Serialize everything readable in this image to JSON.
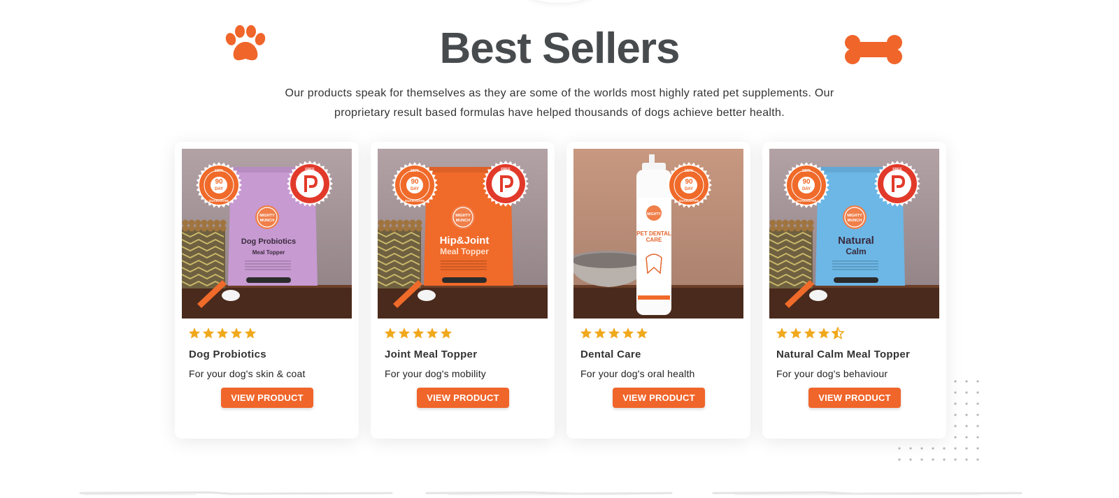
{
  "section": {
    "title": "Best Sellers",
    "subtitle": "Our products speak for themselves as they are some of the worlds most highly rated pet supplements. Our proprietary result based formulas have helped thousands of dogs achieve better health.",
    "decor_left_icon": "paw-print-icon",
    "decor_right_icon": "bone-icon"
  },
  "colors": {
    "accent": "#f0652a",
    "title": "#474b4d",
    "star": "#f0a81c"
  },
  "products": [
    {
      "name": "Dog Probiotics",
      "description": "For your dog's skin & coat",
      "rating": 5,
      "button_label": "VIEW PRODUCT",
      "image": {
        "kind": "pouch",
        "color": "#c79ad2",
        "brand": "MIGHTY MUNCH",
        "label_line1": "Dog Probiotics",
        "label_line2": "Meal Topper",
        "badge_left_top": "100% MONEY BACK",
        "badge_left_days": "90 DAY",
        "badge_left_bottom": "GUARANTEE",
        "badge_right": "FREE SHIPPING"
      }
    },
    {
      "name": "Joint Meal Topper",
      "description": "For your dog's mobility",
      "rating": 5,
      "button_label": "VIEW PRODUCT",
      "image": {
        "kind": "pouch",
        "color": "#f06a2a",
        "brand": "MIGHTY MUNCH",
        "label_line1": "Hip&Joint",
        "label_line2": "Meal Topper",
        "badge_left_top": "100% MONEY BACK",
        "badge_left_days": "90 DAY",
        "badge_left_bottom": "GUARANTEE",
        "badge_right": "FREE SHIPPING"
      }
    },
    {
      "name": "Dental Care",
      "description": "For your dog's oral health",
      "rating": 5,
      "button_label": "VIEW PRODUCT",
      "image": {
        "kind": "bottle",
        "color": "#ffffff",
        "brand": "MIGHTY",
        "label_line1": "PET DENTAL",
        "label_line2": "CARE",
        "badge_left_top": "100% MONEY BACK",
        "badge_left_days": "90 DAY",
        "badge_left_bottom": "GUARANTEE",
        "badge_right": ""
      }
    },
    {
      "name": "Natural Calm Meal Topper",
      "description": "For your dog's behaviour",
      "rating": 4.5,
      "button_label": "VIEW PRODUCT",
      "image": {
        "kind": "pouch",
        "color": "#6cb7e6",
        "brand": "MIGHTY MUNCH",
        "label_line1": "Natural",
        "label_line2": "Calm",
        "badge_left_top": "100% MONEY BACK",
        "badge_left_days": "90 DAY",
        "badge_left_bottom": "GUARANTEE",
        "badge_right": "FREE SHIPPING"
      }
    }
  ]
}
